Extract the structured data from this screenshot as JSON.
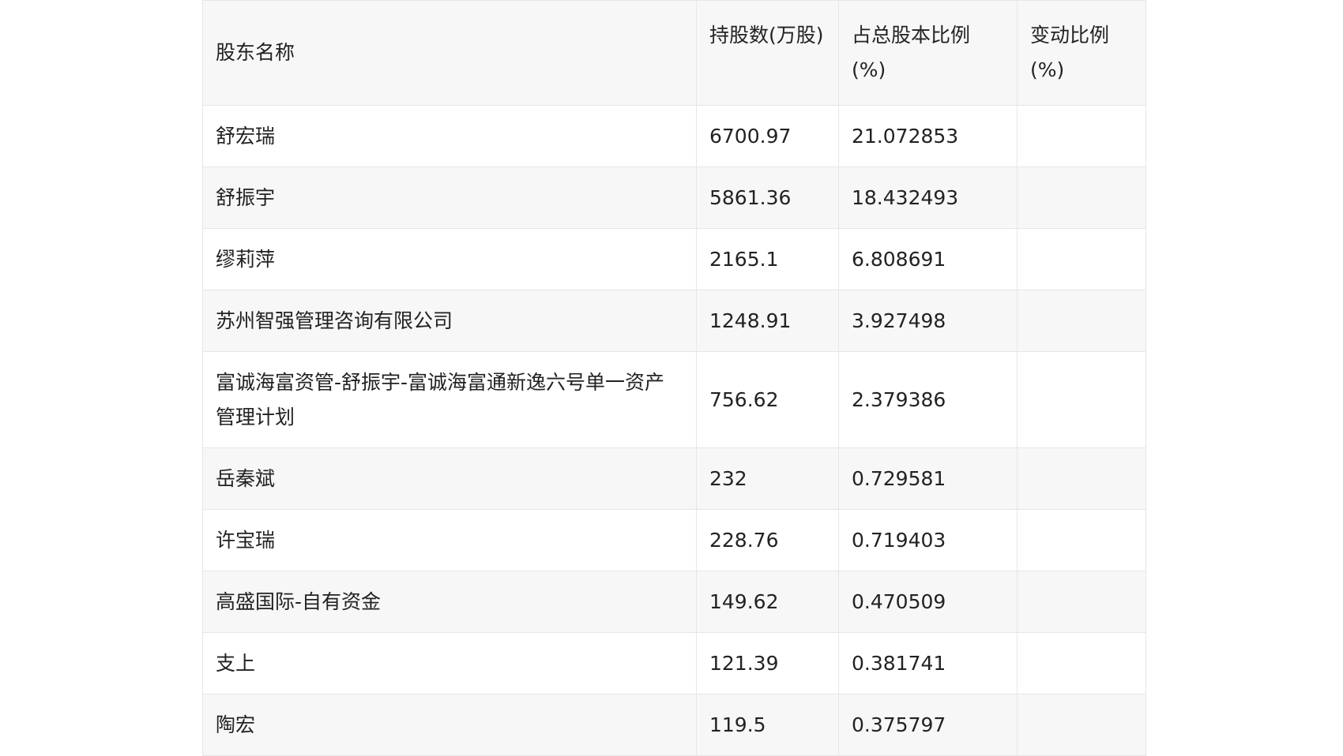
{
  "table": {
    "headers": [
      "股东名称",
      "持股数(万股)",
      "占总股本比例(%)",
      "变动比例(%)"
    ],
    "rows": [
      [
        "舒宏瑞",
        "6700.97",
        "21.072853",
        ""
      ],
      [
        "舒振宇",
        "5861.36",
        "18.432493",
        ""
      ],
      [
        "缪莉萍",
        "2165.1",
        "6.808691",
        ""
      ],
      [
        "苏州智强管理咨询有限公司",
        "1248.91",
        "3.927498",
        ""
      ],
      [
        "富诚海富资管-舒振宇-富诚海富通新逸六号单一资产管理计划",
        "756.62",
        "2.379386",
        ""
      ],
      [
        "岳秦斌",
        "232",
        "0.729581",
        ""
      ],
      [
        "许宝瑞",
        "228.76",
        "0.719403",
        ""
      ],
      [
        "高盛国际-自有资金",
        "149.62",
        "0.470509",
        ""
      ],
      [
        "支上",
        "121.39",
        "0.381741",
        ""
      ],
      [
        "陶宏",
        "119.5",
        "0.375797",
        ""
      ]
    ]
  }
}
